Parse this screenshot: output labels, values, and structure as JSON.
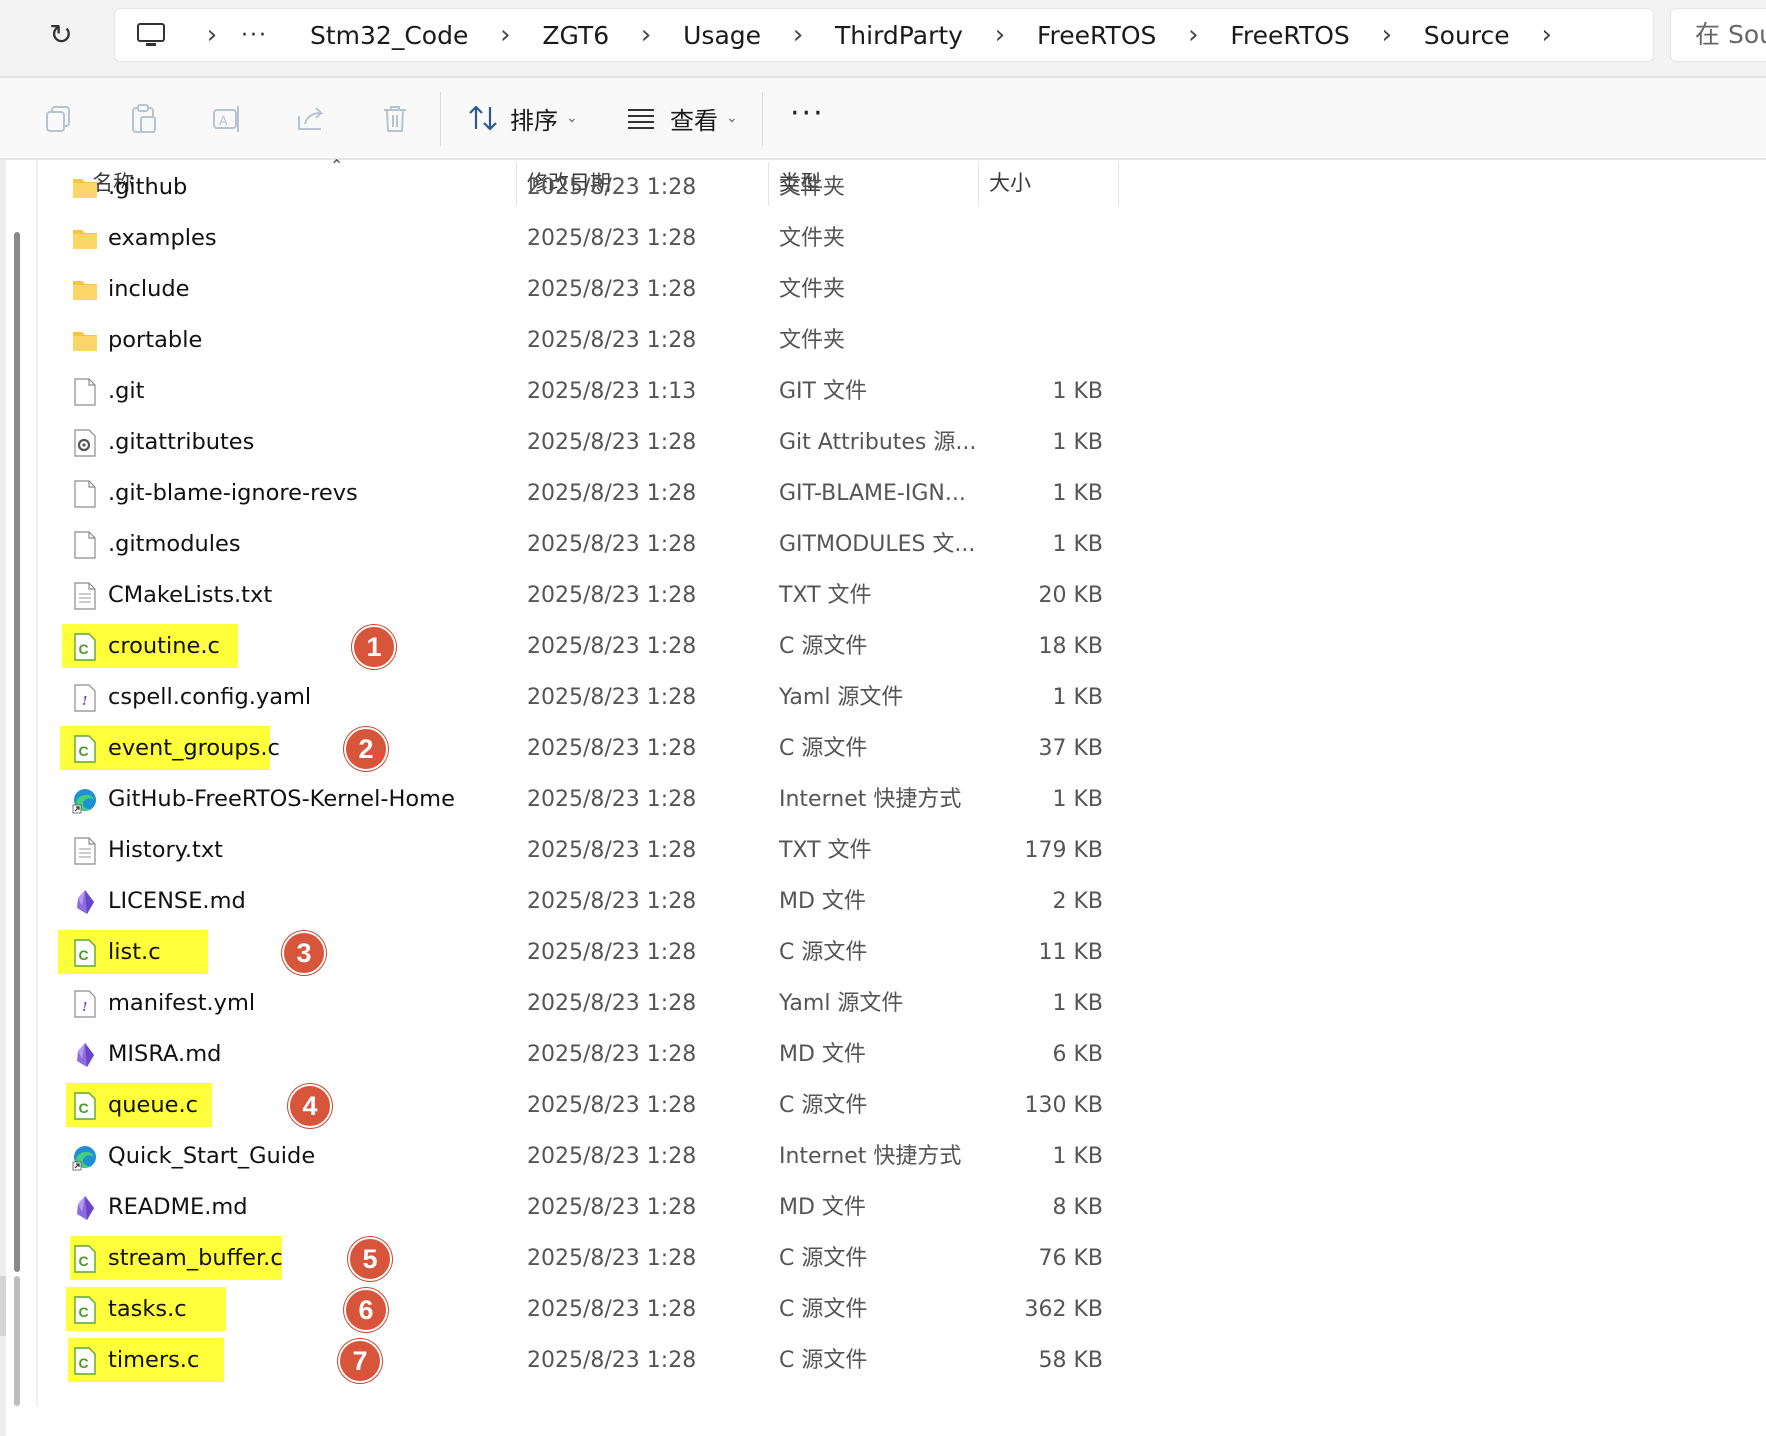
{
  "breadcrumb": {
    "items": [
      "Stm32_Code",
      "ZGT6",
      "Usage",
      "ThirdParty",
      "FreeRTOS",
      "FreeRTOS",
      "Source"
    ],
    "overflow": "···",
    "separator": "›"
  },
  "search": {
    "placeholder": "在 Sou"
  },
  "toolbar": {
    "sort_label": "排序",
    "view_label": "查看",
    "more_label": "···"
  },
  "columns": {
    "name": "名称",
    "date": "修改日期",
    "type": "类型",
    "size": "大小"
  },
  "colors": {
    "highlight": "#ffff3c",
    "badge": "#d7553b",
    "c_file_icon": "#5aa832",
    "folder": "#f6c642"
  },
  "files": [
    {
      "name": ".github",
      "date": "2025/8/23 1:28",
      "type": "文件夹",
      "size": "",
      "icon": "folder-icon",
      "highlight": false,
      "badge": ""
    },
    {
      "name": "examples",
      "date": "2025/8/23 1:28",
      "type": "文件夹",
      "size": "",
      "icon": "folder-icon",
      "highlight": false,
      "badge": ""
    },
    {
      "name": "include",
      "date": "2025/8/23 1:28",
      "type": "文件夹",
      "size": "",
      "icon": "folder-icon",
      "highlight": false,
      "badge": ""
    },
    {
      "name": "portable",
      "date": "2025/8/23 1:28",
      "type": "文件夹",
      "size": "",
      "icon": "folder-icon",
      "highlight": false,
      "badge": ""
    },
    {
      "name": ".git",
      "date": "2025/8/23 1:13",
      "type": "GIT 文件",
      "size": "1 KB",
      "icon": "blank-file-icon",
      "highlight": false,
      "badge": ""
    },
    {
      "name": ".gitattributes",
      "date": "2025/8/23 1:28",
      "type": "Git Attributes 源...",
      "size": "1 KB",
      "icon": "settings-file-icon",
      "highlight": false,
      "badge": ""
    },
    {
      "name": ".git-blame-ignore-revs",
      "date": "2025/8/23 1:28",
      "type": "GIT-BLAME-IGN...",
      "size": "1 KB",
      "icon": "blank-file-icon",
      "highlight": false,
      "badge": ""
    },
    {
      "name": ".gitmodules",
      "date": "2025/8/23 1:28",
      "type": "GITMODULES 文...",
      "size": "1 KB",
      "icon": "blank-file-icon",
      "highlight": false,
      "badge": ""
    },
    {
      "name": "CMakeLists.txt",
      "date": "2025/8/23 1:28",
      "type": "TXT 文件",
      "size": "20 KB",
      "icon": "text-file-icon",
      "highlight": false,
      "badge": ""
    },
    {
      "name": "croutine.c",
      "date": "2025/8/23 1:28",
      "type": "C 源文件",
      "size": "18 KB",
      "icon": "c-source-icon",
      "highlight": true,
      "badge": "1"
    },
    {
      "name": "cspell.config.yaml",
      "date": "2025/8/23 1:28",
      "type": "Yaml 源文件",
      "size": "1 KB",
      "icon": "yaml-file-icon",
      "highlight": false,
      "badge": ""
    },
    {
      "name": "event_groups.c",
      "date": "2025/8/23 1:28",
      "type": "C 源文件",
      "size": "37 KB",
      "icon": "c-source-icon",
      "highlight": true,
      "badge": "2"
    },
    {
      "name": "GitHub-FreeRTOS-Kernel-Home",
      "date": "2025/8/23 1:28",
      "type": "Internet 快捷方式",
      "size": "1 KB",
      "icon": "edge-shortcut-icon",
      "highlight": false,
      "badge": ""
    },
    {
      "name": "History.txt",
      "date": "2025/8/23 1:28",
      "type": "TXT 文件",
      "size": "179 KB",
      "icon": "text-file-icon",
      "highlight": false,
      "badge": ""
    },
    {
      "name": "LICENSE.md",
      "date": "2025/8/23 1:28",
      "type": "MD 文件",
      "size": "2 KB",
      "icon": "markdown-crystal-icon",
      "highlight": false,
      "badge": ""
    },
    {
      "name": "list.c",
      "date": "2025/8/23 1:28",
      "type": "C 源文件",
      "size": "11 KB",
      "icon": "c-source-icon",
      "highlight": true,
      "badge": "3"
    },
    {
      "name": "manifest.yml",
      "date": "2025/8/23 1:28",
      "type": "Yaml 源文件",
      "size": "1 KB",
      "icon": "yaml-file-icon",
      "highlight": false,
      "badge": ""
    },
    {
      "name": "MISRA.md",
      "date": "2025/8/23 1:28",
      "type": "MD 文件",
      "size": "6 KB",
      "icon": "markdown-crystal-icon",
      "highlight": false,
      "badge": ""
    },
    {
      "name": "queue.c",
      "date": "2025/8/23 1:28",
      "type": "C 源文件",
      "size": "130 KB",
      "icon": "c-source-icon",
      "highlight": true,
      "badge": "4"
    },
    {
      "name": "Quick_Start_Guide",
      "date": "2025/8/23 1:28",
      "type": "Internet 快捷方式",
      "size": "1 KB",
      "icon": "edge-shortcut-icon",
      "highlight": false,
      "badge": ""
    },
    {
      "name": "README.md",
      "date": "2025/8/23 1:28",
      "type": "MD 文件",
      "size": "8 KB",
      "icon": "markdown-crystal-icon",
      "highlight": false,
      "badge": ""
    },
    {
      "name": "stream_buffer.c",
      "date": "2025/8/23 1:28",
      "type": "C 源文件",
      "size": "76 KB",
      "icon": "c-source-icon",
      "highlight": true,
      "badge": "5"
    },
    {
      "name": "tasks.c",
      "date": "2025/8/23 1:28",
      "type": "C 源文件",
      "size": "362 KB",
      "icon": "c-source-icon",
      "highlight": true,
      "badge": "6"
    },
    {
      "name": "timers.c",
      "date": "2025/8/23 1:28",
      "type": "C 源文件",
      "size": "58 KB",
      "icon": "c-source-icon",
      "highlight": true,
      "badge": "7"
    }
  ]
}
